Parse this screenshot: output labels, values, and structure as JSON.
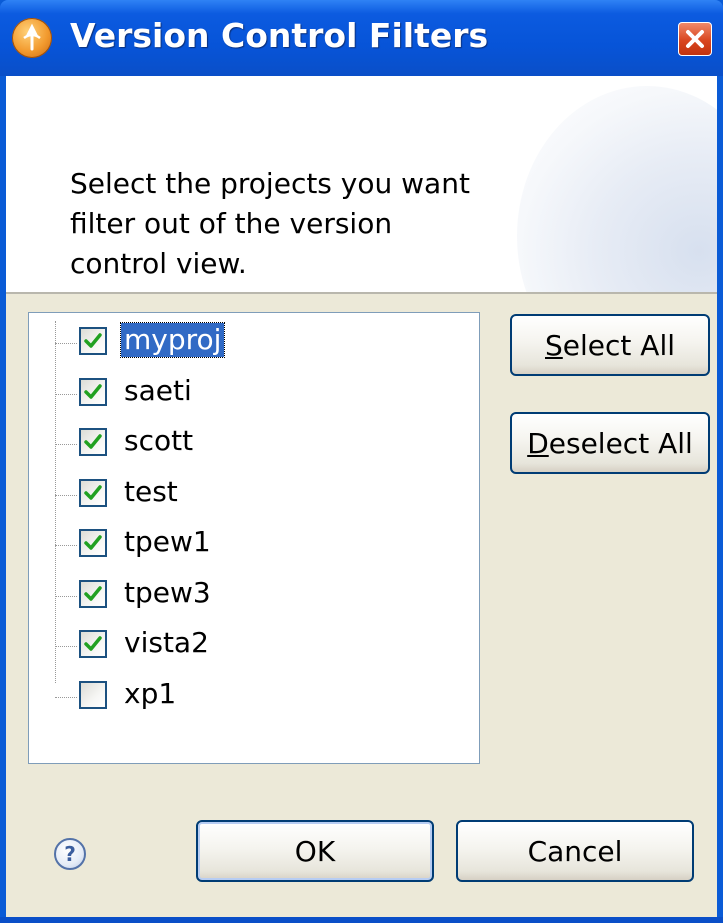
{
  "window": {
    "title": "Version Control Filters",
    "app_icon": "eclipse-orange-icon",
    "close_icon": "close-icon"
  },
  "banner": {
    "message": "Select the projects you want\nfilter out of the version\ncontrol view."
  },
  "projects": [
    {
      "name": "myproj",
      "checked": true,
      "selected": true
    },
    {
      "name": "saeti",
      "checked": true,
      "selected": false
    },
    {
      "name": "scott",
      "checked": true,
      "selected": false
    },
    {
      "name": "test",
      "checked": true,
      "selected": false
    },
    {
      "name": "tpew1",
      "checked": true,
      "selected": false
    },
    {
      "name": "tpew3",
      "checked": true,
      "selected": false
    },
    {
      "name": "vista2",
      "checked": true,
      "selected": false
    },
    {
      "name": "xp1",
      "checked": false,
      "selected": false
    }
  ],
  "buttons": {
    "select_all_mnemonic": "S",
    "select_all_rest": "elect All",
    "deselect_all_mnemonic": "D",
    "deselect_all_rest": "eselect All",
    "ok": "OK",
    "cancel": "Cancel",
    "help": "?"
  },
  "colors": {
    "titlebar": "#0754d8",
    "selection": "#316ac5",
    "check": "#21a121",
    "dialog_bg": "#ece9d8"
  }
}
